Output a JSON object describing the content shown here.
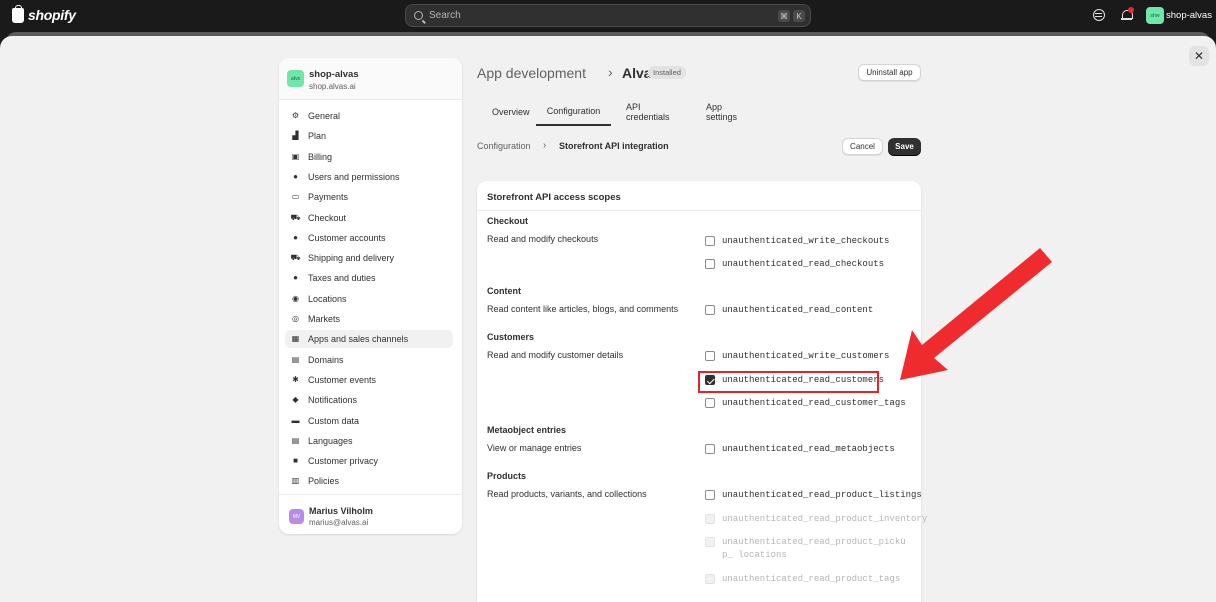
{
  "topbar": {
    "brand": "shopify",
    "search_placeholder": "Search",
    "shortcut_keys": [
      "⌘",
      "K"
    ],
    "shop_badge": "shw",
    "shop_name": "shop-alvas",
    "icons": [
      "database-icon",
      "bell-icon"
    ]
  },
  "sidebar": {
    "shop_name": "shop-alvas",
    "shop_domain": "shop.alvas.ai",
    "avatar_text": "alvs",
    "items": [
      {
        "label": "General",
        "icon": "⚙"
      },
      {
        "label": "Plan",
        "icon": "▟"
      },
      {
        "label": "Billing",
        "icon": "▣"
      },
      {
        "label": "Users and permissions",
        "icon": "●"
      },
      {
        "label": "Payments",
        "icon": "▭"
      },
      {
        "label": "Checkout",
        "icon": "⛟"
      },
      {
        "label": "Customer accounts",
        "icon": "●"
      },
      {
        "label": "Shipping and delivery",
        "icon": "⛟"
      },
      {
        "label": "Taxes and duties",
        "icon": "●"
      },
      {
        "label": "Locations",
        "icon": "◉"
      },
      {
        "label": "Markets",
        "icon": "◎"
      },
      {
        "label": "Apps and sales channels",
        "icon": "▦"
      },
      {
        "label": "Domains",
        "icon": "▤"
      },
      {
        "label": "Customer events",
        "icon": "✱"
      },
      {
        "label": "Notifications",
        "icon": "◆"
      },
      {
        "label": "Custom data",
        "icon": "▬"
      },
      {
        "label": "Languages",
        "icon": "▤"
      },
      {
        "label": "Customer privacy",
        "icon": "■"
      },
      {
        "label": "Policies",
        "icon": "▥"
      }
    ],
    "active_item": "Apps and sales channels",
    "user": {
      "initials": "MV",
      "name": "Marius Vilholm",
      "email": "marius@alvas.ai"
    }
  },
  "header": {
    "breadcrumb_root": "App development",
    "breadcrumb_sep": "›",
    "app_name": "Alvas",
    "status_badge": "Installed",
    "uninstall_label": "Uninstall app"
  },
  "tabs": [
    {
      "label": "Overview",
      "active": false
    },
    {
      "label": "Configuration",
      "active": true
    },
    {
      "label": "API credentials",
      "active": false
    },
    {
      "label": "App settings",
      "active": false
    }
  ],
  "config_bar": {
    "crumb": "Configuration",
    "sep": "›",
    "current": "Storefront API integration",
    "cancel_label": "Cancel",
    "save_label": "Save"
  },
  "card": {
    "title": "Storefront API access scopes",
    "groups": [
      {
        "title": "Checkout",
        "description": "Read and modify checkouts",
        "scopes": [
          {
            "label": "unauthenticated_write_checkouts",
            "checked": false,
            "disabled": false
          },
          {
            "label": "unauthenticated_read_checkouts",
            "checked": false,
            "disabled": false
          }
        ]
      },
      {
        "title": "Content",
        "description": "Read content like articles, blogs, and comments",
        "scopes": [
          {
            "label": "unauthenticated_read_content",
            "checked": false,
            "disabled": false
          }
        ]
      },
      {
        "title": "Customers",
        "description": "Read and modify customer details",
        "scopes": [
          {
            "label": "unauthenticated_write_customers",
            "checked": false,
            "disabled": false
          },
          {
            "label": "unauthenticated_read_customers",
            "checked": true,
            "disabled": false
          },
          {
            "label": "unauthenticated_read_customer_tags",
            "checked": false,
            "disabled": false
          }
        ]
      },
      {
        "title": "Metaobject entries",
        "description": "View or manage entries",
        "scopes": [
          {
            "label": "unauthenticated_read_metaobjects",
            "checked": false,
            "disabled": false
          }
        ]
      },
      {
        "title": "Products",
        "description": "Read products, variants, and collections",
        "scopes": [
          {
            "label": "unauthenticated_read_product_listings",
            "checked": false,
            "disabled": false
          },
          {
            "label": "unauthenticated_read_product_inventory",
            "checked": false,
            "disabled": true
          },
          {
            "label": "unauthenticated_read_product_pickup_ locations",
            "checked": false,
            "disabled": true
          },
          {
            "label": "unauthenticated_read_product_tags",
            "checked": false,
            "disabled": true
          }
        ]
      }
    ]
  },
  "annotation": {
    "highlight_color": "#e52229",
    "arrow_color": "#ef2b2d"
  }
}
